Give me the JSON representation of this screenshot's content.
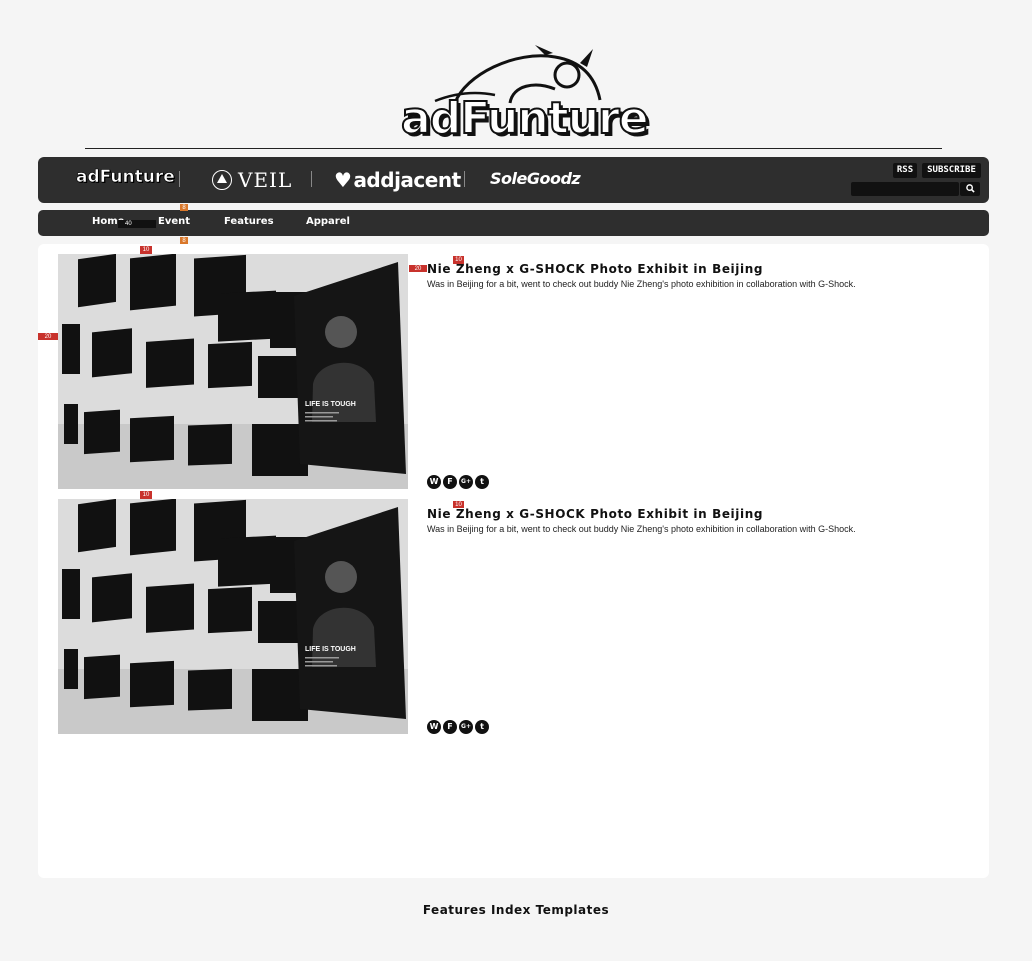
{
  "site": {
    "logo_text": "adFunture"
  },
  "brands": [
    {
      "label": "adFunture"
    },
    {
      "label": "VEIL"
    },
    {
      "label": "addjacent"
    },
    {
      "label": "SoleGoodz"
    }
  ],
  "header_actions": {
    "rss_label": "RSS",
    "subscribe_label": "SUBSCRIBE",
    "search_placeholder": ""
  },
  "nav": {
    "items": [
      {
        "label": "Home"
      },
      {
        "label": "Event"
      },
      {
        "label": "Features"
      },
      {
        "label": "Apparel"
      }
    ]
  },
  "debug_markers": {
    "nav_strip": "40",
    "event_top": "8",
    "event_bottom": "8",
    "post1_thumb": "10",
    "post1_title": "10",
    "post1_side": "20",
    "panel_left": "20",
    "post2_thumb": "10",
    "post2_title": "10"
  },
  "posts": [
    {
      "title": "Nie Zheng x G-SHOCK Photo Exhibit in Beijing",
      "excerpt": "Was in Beijing for a bit, went to check out buddy Nie Zheng's photo exhibition in collaboration with G-Shock.",
      "image_caption": "LIFE IS TOUGH",
      "share": [
        "W",
        "F",
        "G+",
        "t"
      ]
    },
    {
      "title": "Nie Zheng x G-SHOCK Photo Exhibit in Beijing",
      "excerpt": "Was in Beijing for a bit, went to check out buddy Nie Zheng's photo exhibition in collaboration with G-Shock.",
      "image_caption": "LIFE IS TOUGH",
      "share": [
        "W",
        "F",
        "G+",
        "t"
      ]
    }
  ],
  "footer": {
    "text": "Features Index Templates"
  },
  "colors": {
    "bar_bg": "#2e2e2e",
    "marker_red": "#c8322c",
    "marker_orange": "#d9772a"
  }
}
